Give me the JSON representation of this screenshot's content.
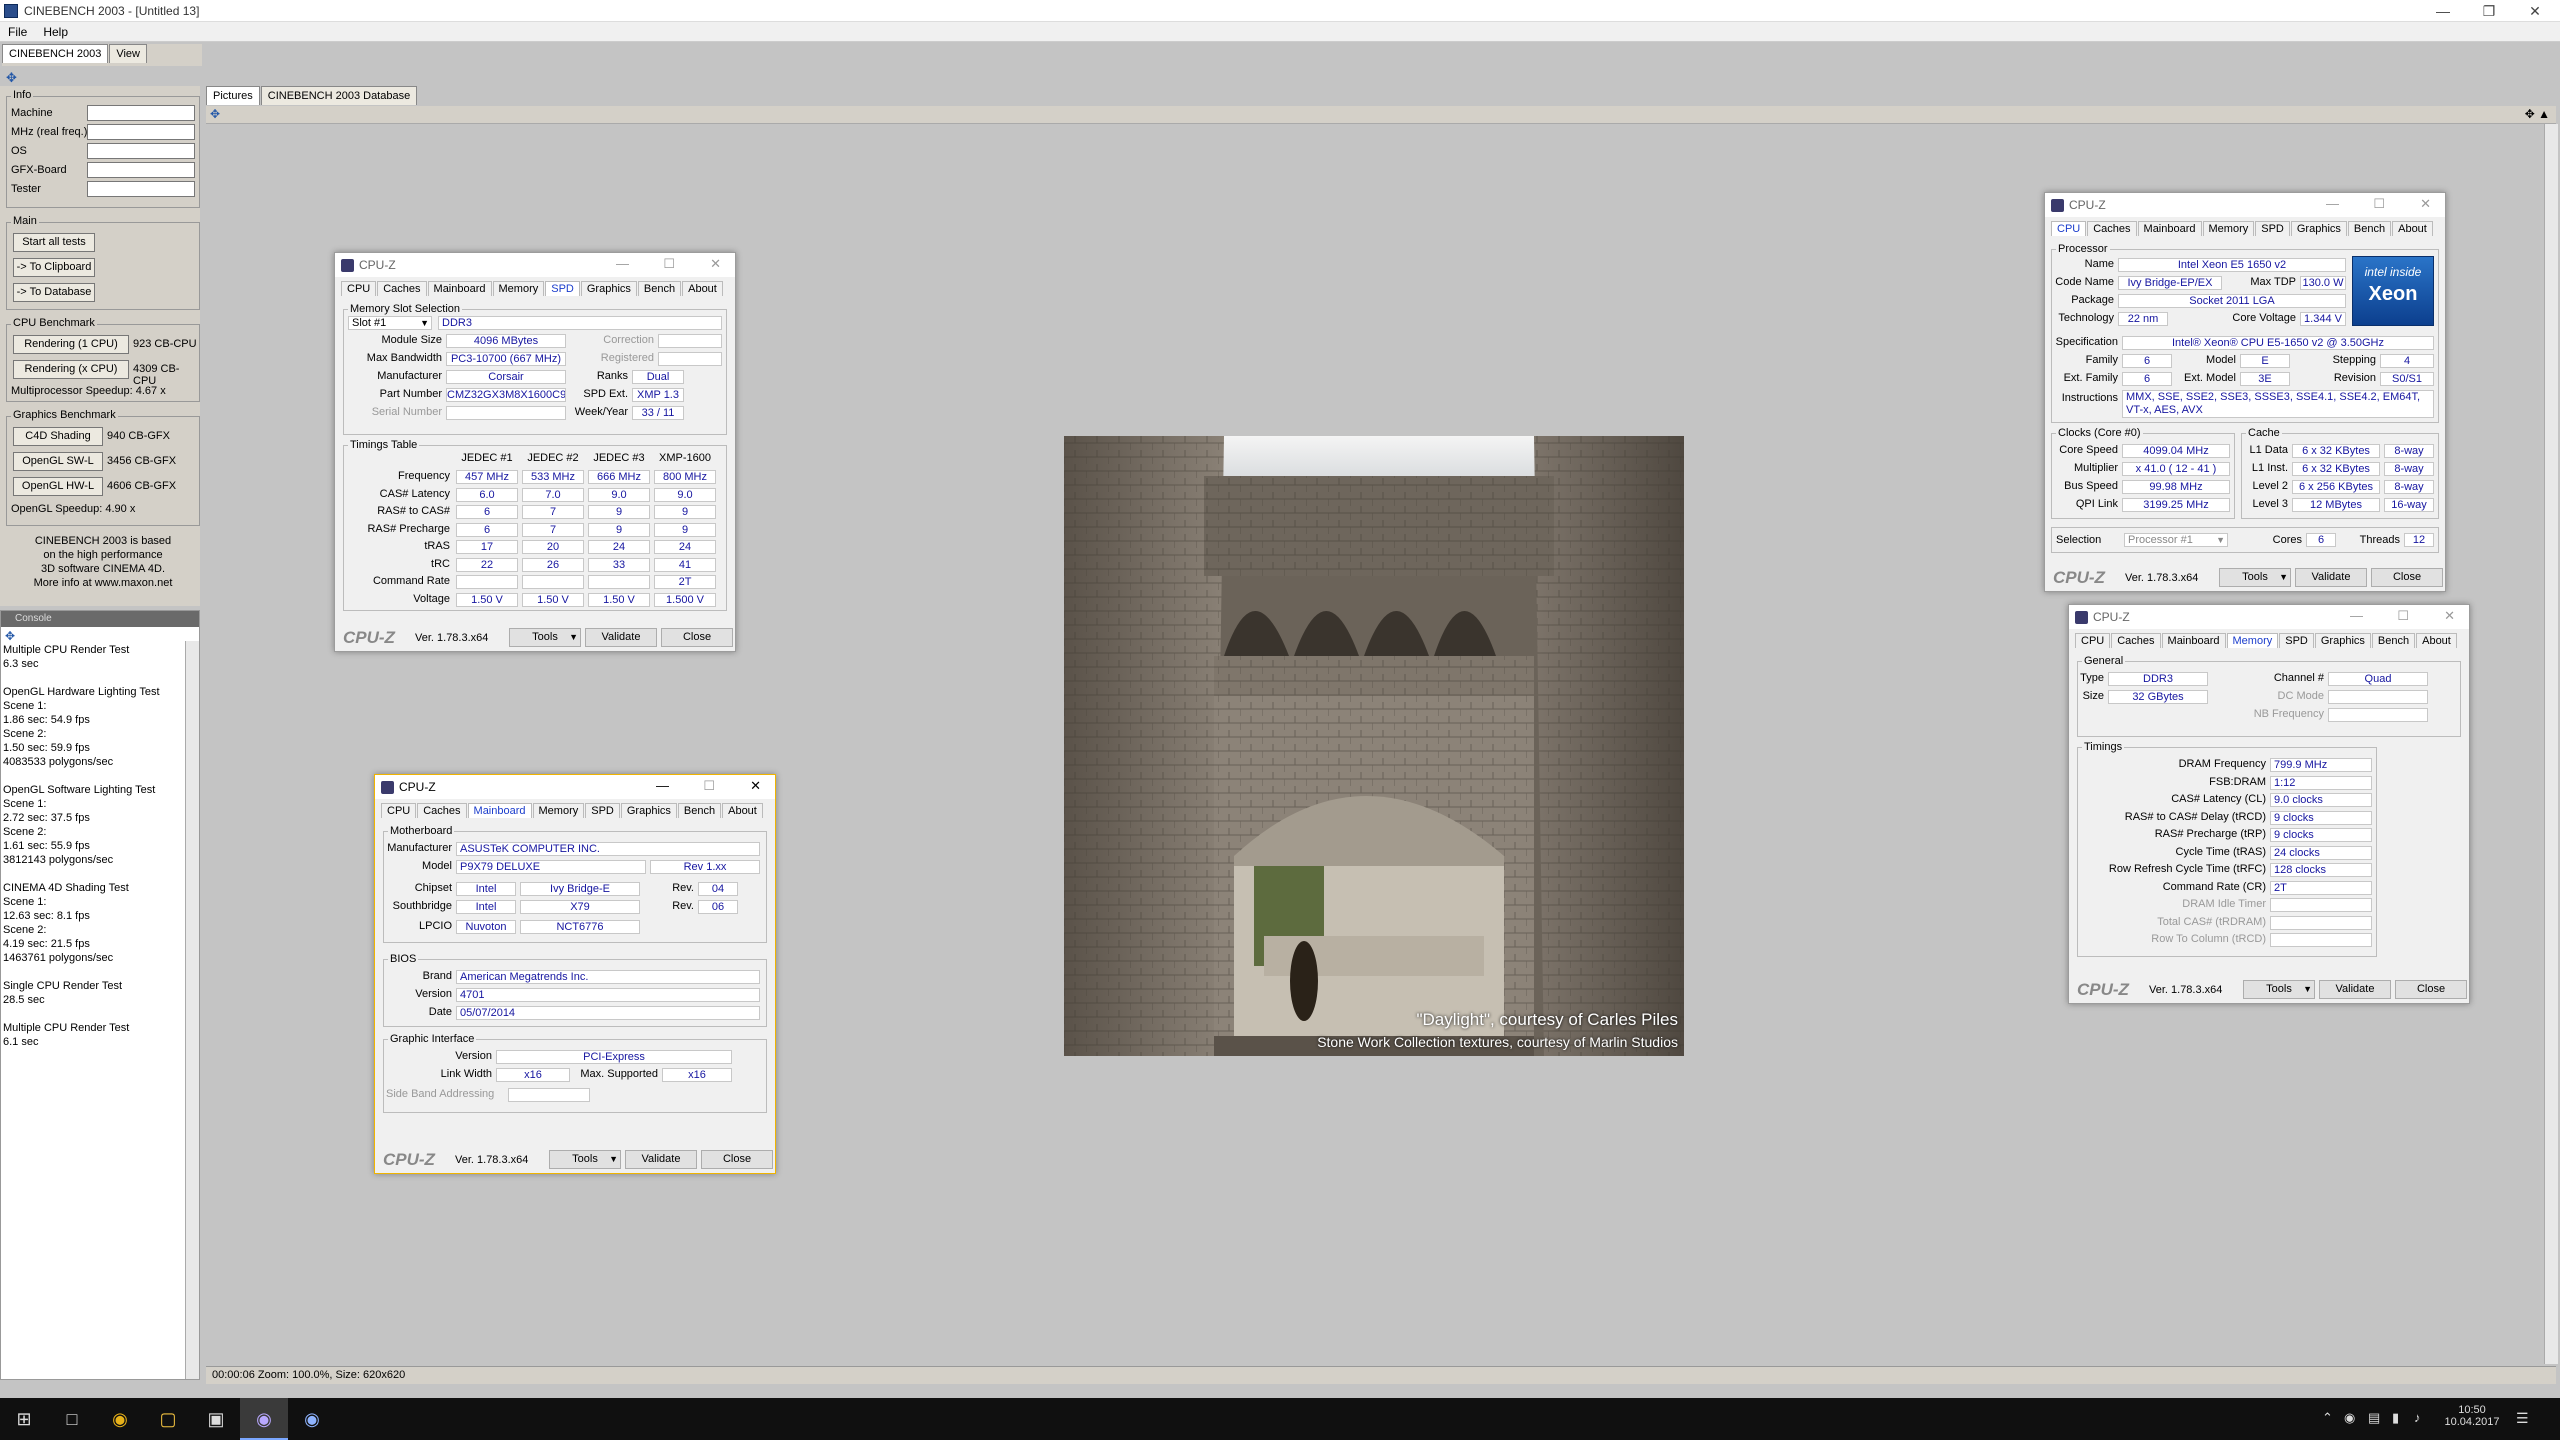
{
  "window": {
    "title": "CINEBENCH 2003 - [Untitled 13]",
    "menu": [
      "File",
      "Help"
    ],
    "tabs": [
      "CINEBENCH 2003",
      "View"
    ],
    "sub_tabs": [
      "Pictures",
      "CINEBENCH 2003 Database"
    ]
  },
  "info": {
    "title": "Info",
    "labels": [
      "Machine",
      "MHz (real freq.)",
      "OS",
      "GFX-Board",
      "Tester"
    ]
  },
  "main": {
    "title": "Main",
    "buttons": [
      "Start all tests",
      "-> To Clipboard",
      "-> To Database"
    ]
  },
  "cpu_bench": {
    "title": "CPU Benchmark",
    "rendering_1": "Rendering (1 CPU)",
    "rendering_1_val": "923 CB-CPU",
    "rendering_x": "Rendering (x CPU)",
    "rendering_x_val": "4309 CB-CPU",
    "speedup": "Multiprocessor Speedup:  4.67 x"
  },
  "gfx_bench": {
    "title": "Graphics Benchmark",
    "c4d": "C4D Shading",
    "c4d_val": "940 CB-GFX",
    "sw": "OpenGL SW-L",
    "sw_val": "3456 CB-GFX",
    "hw": "OpenGL HW-L",
    "hw_val": "4606 CB-GFX",
    "speedup": "OpenGL Speedup:  4.90 x"
  },
  "about_text": [
    "CINEBENCH 2003 is based",
    "on the high performance",
    "3D software CINEMA 4D.",
    "More info at www.maxon.net"
  ],
  "console": {
    "header": "Console",
    "log": "Multiple CPU Render Test\n6.3 sec\n\nOpenGL Hardware Lighting Test\nScene 1:\n1.86 sec: 54.9 fps\nScene 2:\n1.50 sec: 59.9 fps\n4083533 polygons/sec\n\nOpenGL Software Lighting Test\nScene 1:\n2.72 sec: 37.5 fps\nScene 2:\n1.61 sec: 55.9 fps\n3812143 polygons/sec\n\nCINEMA 4D Shading Test\nScene 1:\n12.63 sec: 8.1 fps\nScene 2:\n4.19 sec: 21.5 fps\n1463761 polygons/sec\n\nSingle CPU Render Test\n28.5 sec\n\nMultiple CPU Render Test\n6.1 sec"
  },
  "status": "00:00:06  Zoom: 100.0%, Size: 620x620",
  "render": {
    "caption1": "\"Daylight\", courtesy of Carles Piles",
    "caption2": "Stone Work Collection textures, courtesy of Marlin Studios"
  },
  "cpuz_common": {
    "title": "CPU-Z",
    "brand": "CPU-Z",
    "version": "Ver. 1.78.3.x64",
    "tools": "Tools",
    "validate": "Validate",
    "close": "Close",
    "tabs": [
      "CPU",
      "Caches",
      "Mainboard",
      "Memory",
      "SPD",
      "Graphics",
      "Bench",
      "About"
    ]
  },
  "spd": {
    "slot_group": "Memory Slot Selection",
    "slot": "Slot #1",
    "type": "DDR3",
    "module_size_l": "Module Size",
    "module_size": "4096 MBytes",
    "max_bw_l": "Max Bandwidth",
    "max_bw": "PC3-10700 (667 MHz)",
    "manuf_l": "Manufacturer",
    "manuf": "Corsair",
    "part_l": "Part Number",
    "part": "CMZ32GX3M8X1600C9",
    "serial_l": "Serial Number",
    "correction_l": "Correction",
    "registered_l": "Registered",
    "ranks_l": "Ranks",
    "ranks": "Dual",
    "spdext_l": "SPD Ext.",
    "spdext": "XMP 1.3",
    "week_l": "Week/Year",
    "week": "33 / 11",
    "timings_group": "Timings Table",
    "cols": [
      "JEDEC #1",
      "JEDEC #2",
      "JEDEC #3",
      "XMP-1600"
    ],
    "rows": [
      {
        "label": "Frequency",
        "vals": [
          "457 MHz",
          "533 MHz",
          "666 MHz",
          "800 MHz"
        ]
      },
      {
        "label": "CAS# Latency",
        "vals": [
          "6.0",
          "7.0",
          "9.0",
          "9.0"
        ]
      },
      {
        "label": "RAS# to CAS#",
        "vals": [
          "6",
          "7",
          "9",
          "9"
        ]
      },
      {
        "label": "RAS# Precharge",
        "vals": [
          "6",
          "7",
          "9",
          "9"
        ]
      },
      {
        "label": "tRAS",
        "vals": [
          "17",
          "20",
          "24",
          "24"
        ]
      },
      {
        "label": "tRC",
        "vals": [
          "22",
          "26",
          "33",
          "41"
        ]
      },
      {
        "label": "Command Rate",
        "vals": [
          "",
          "",
          "",
          "2T"
        ]
      },
      {
        "label": "Voltage",
        "vals": [
          "1.50 V",
          "1.50 V",
          "1.50 V",
          "1.500 V"
        ]
      }
    ]
  },
  "mainboard": {
    "mb_group": "Motherboard",
    "manuf_l": "Manufacturer",
    "manuf": "ASUSTeK COMPUTER INC.",
    "model_l": "Model",
    "model": "P9X79 DELUXE",
    "model_rev": "Rev 1.xx",
    "chipset_l": "Chipset",
    "chipset": "Intel",
    "chipset2": "Ivy Bridge-E",
    "rev_l": "Rev.",
    "chipset_rev": "04",
    "south_l": "Southbridge",
    "south": "Intel",
    "south2": "X79",
    "south_rev": "06",
    "lpcio_l": "LPCIO",
    "lpcio": "Nuvoton",
    "lpcio2": "NCT6776",
    "bios_group": "BIOS",
    "brand_l": "Brand",
    "brand": "American Megatrends Inc.",
    "version_l": "Version",
    "version": "4701",
    "date_l": "Date",
    "date": "05/07/2014",
    "gi_group": "Graphic Interface",
    "giver_l": "Version",
    "giver": "PCI-Express",
    "lw_l": "Link Width",
    "lw": "x16",
    "ms_l": "Max. Supported",
    "ms": "x16",
    "sba_l": "Side Band Addressing"
  },
  "cpu": {
    "proc_group": "Processor",
    "name_l": "Name",
    "name": "Intel Xeon E5 1650 v2",
    "code_l": "Code Name",
    "code": "Ivy Bridge-EP/EX",
    "tdp_l": "Max TDP",
    "tdp": "130.0 W",
    "pkg_l": "Package",
    "pkg": "Socket 2011 LGA",
    "tech_l": "Technology",
    "tech": "22 nm",
    "cv_l": "Core Voltage",
    "cv": "1.344 V",
    "spec_l": "Specification",
    "spec": "Intel® Xeon® CPU E5-1650 v2 @ 3.50GHz",
    "fam_l": "Family",
    "fam": "6",
    "model_l": "Model",
    "model": "E",
    "step_l": "Stepping",
    "step": "4",
    "efam_l": "Ext. Family",
    "efam": "6",
    "emod_l": "Ext. Model",
    "emod": "3E",
    "rev_l": "Revision",
    "rev": "S0/S1",
    "instr_l": "Instructions",
    "instr": "MMX, SSE, SSE2, SSE3, SSSE3, SSE4.1, SSE4.2, EM64T, VT-x, AES, AVX",
    "clocks_group": "Clocks (Core #0)",
    "cs_l": "Core Speed",
    "cs": "4099.04 MHz",
    "mult_l": "Multiplier",
    "mult": "x 41.0 ( 12 - 41 )",
    "bus_l": "Bus Speed",
    "bus": "99.98 MHz",
    "qpi_l": "QPI Link",
    "qpi": "3199.25 MHz",
    "cache_group": "Cache",
    "l1d_l": "L1 Data",
    "l1d": "6 x 32 KBytes",
    "l1d_w": "8-way",
    "l1i_l": "L1 Inst.",
    "l1i": "6 x 32 KBytes",
    "l1i_w": "8-way",
    "l2_l": "Level 2",
    "l2": "6 x 256 KBytes",
    "l2_w": "8-way",
    "l3_l": "Level 3",
    "l3": "12 MBytes",
    "l3_w": "16-way",
    "sel_l": "Selection",
    "sel": "Processor #1",
    "cores_l": "Cores",
    "cores": "6",
    "threads_l": "Threads",
    "threads": "12",
    "logo_line1": "intel inside",
    "logo_line2": "Xeon"
  },
  "memory": {
    "gen_group": "General",
    "type_l": "Type",
    "type": "DDR3",
    "ch_l": "Channel #",
    "ch": "Quad",
    "size_l": "Size",
    "size": "32 GBytes",
    "dc_l": "DC Mode",
    "nb_l": "NB Frequency",
    "tim_group": "Timings",
    "rows": [
      {
        "label": "DRAM Frequency",
        "val": "799.9 MHz",
        "dim": false
      },
      {
        "label": "FSB:DRAM",
        "val": "1:12",
        "dim": false
      },
      {
        "label": "CAS# Latency (CL)",
        "val": "9.0 clocks",
        "dim": false
      },
      {
        "label": "RAS# to CAS# Delay (tRCD)",
        "val": "9 clocks",
        "dim": false
      },
      {
        "label": "RAS# Precharge (tRP)",
        "val": "9 clocks",
        "dim": false
      },
      {
        "label": "Cycle Time (tRAS)",
        "val": "24 clocks",
        "dim": false
      },
      {
        "label": "Row Refresh Cycle Time (tRFC)",
        "val": "128 clocks",
        "dim": false
      },
      {
        "label": "Command Rate (CR)",
        "val": "2T",
        "dim": false
      },
      {
        "label": "DRAM Idle Timer",
        "val": "",
        "dim": true
      },
      {
        "label": "Total CAS# (tRDRAM)",
        "val": "",
        "dim": true
      },
      {
        "label": "Row To Column (tRCD)",
        "val": "",
        "dim": true
      }
    ]
  },
  "taskbar": {
    "time": "10:50",
    "date": "10.04.2017"
  }
}
